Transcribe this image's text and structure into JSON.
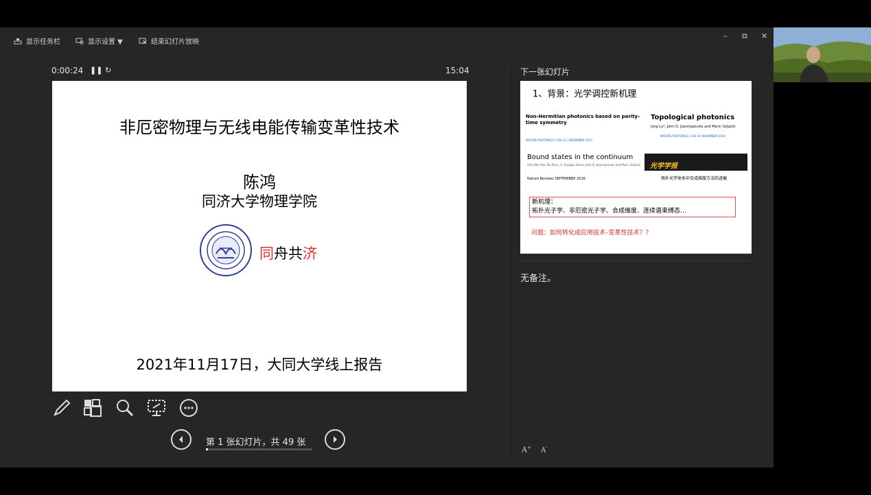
{
  "toolbar": {
    "show_taskbar": "显示任务栏",
    "display_settings": "显示设置 ▼",
    "end_show": "结束幻灯片放映"
  },
  "window_controls": {
    "minimize": "–",
    "restore": "⧉",
    "close": "✕"
  },
  "presenter": {
    "elapsed": "0:00:24",
    "clock": "15:04",
    "pause_icon": "pause-icon",
    "restart_icon": "restart-icon"
  },
  "current_slide": {
    "title": "非厄密物理与无线电能传输变革性技术",
    "author": "陈鸿",
    "institution": "同济大学物理学院",
    "motto_parts": [
      "同",
      "舟共",
      "济"
    ],
    "date_line": "2021年11月17日，大同大学线上报告",
    "seal_text": "同济大学 1907 TONGJI UNIVERSITY"
  },
  "tools": [
    "pen-icon",
    "slide-grid-icon",
    "zoom-icon",
    "screen-icon",
    "more-icon"
  ],
  "navigation": {
    "status": "第 1 张幻灯片，共 49 张",
    "current": 1,
    "total": 49,
    "progress": 0.02
  },
  "next_slide": {
    "label": "下一张幻灯片",
    "title": "1、背景：光学调控新机理",
    "paper1_title": "Non-Hermitian photonics based on parity–time symmetry",
    "paper1_meta": "NATURE PHOTONICS | VOL 11 | DECEMBER 2017",
    "paper2_title": "Topological photonics",
    "paper2_authors": "Ling Lu*, John D. Joannopoulos and Marin Soljačić",
    "paper2_meta": "NATURE PHOTONICS | VOL 8 | NOVEMBER 2014",
    "paper3_title": "Bound states in the continuum",
    "paper3_authors": "Chia Wei Hsu, Bo Zhen, A. Douglas Stone, John D. Joannopoulos and Marin Soljačić",
    "paper3_meta": "Nature Reviews  SEPTEMBER 2016",
    "journal": "光学学报",
    "paper4_title": "拓扑光学体系中合成维度方法的进展",
    "box_line1": "新机理：",
    "box_line2": "拓扑光子学、非厄密光子学、合成维度、连续谱束缚态…",
    "question": "问题：如何转化成应用技术–变革性技术？？"
  },
  "notes": {
    "text": "无备注。"
  },
  "font_buttons": [
    "A",
    "A"
  ],
  "colors": {
    "background": "#262626",
    "accent_red": "#e03030",
    "seal_blue": "#2b3f9b"
  }
}
